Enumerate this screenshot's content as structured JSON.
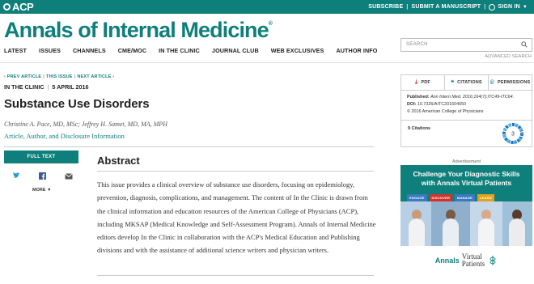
{
  "topbar": {
    "logo_text": "ACP",
    "links": [
      "SUBSCRIBE",
      "SUBMIT A MANUSCRIPT"
    ],
    "signin": "SIGN IN",
    "color": "#0e7f7b"
  },
  "masthead": {
    "title": "Annals of Internal Medicine",
    "mark": "®"
  },
  "search": {
    "placeholder": "SEARCH",
    "advanced": "ADVANCED SEARCH"
  },
  "nav": [
    "LATEST",
    "ISSUES",
    "CHANNELS",
    "CME/MOC",
    "IN THE CLINIC",
    "JOURNAL CLUB",
    "WEB EXCLUSIVES",
    "AUTHOR INFO"
  ],
  "article_nav": {
    "prev": "‹ PREV ARTICLE",
    "this": "THIS ISSUE",
    "next": "NEXT ARTICLE ›"
  },
  "article": {
    "section": "IN THE CLINIC",
    "date": "5 APRIL 2016",
    "title": "Substance Use Disorders",
    "authors": "Christine A. Pace, MD, MSc; Jeffrey H. Samet, MD, MA, MPH",
    "disclosure_link": "Article, Author, and Disclosure Information",
    "full_text_button": "FULL TEXT",
    "more": "MORE",
    "abstract_title": "Abstract",
    "abstract_text": "This issue provides a clinical overview of substance use disorders, focusing on epidemiology, prevention, diagnosis, complications, and management. The content of In the Clinic is drawn from the clinical information and education resources of the American College of Physicians (ACP), including MKSAP (Medical Knowledge and Self-Assessment Program). Annals of Internal Medicine editors develop In the Clinic in collaboration with the ACP's Medical Education and Publishing divisions and with the assistance of additional science writers and physician writers."
  },
  "tools": {
    "pdf": "PDF",
    "citations": "CITATIONS",
    "permissions": "PERMISSIONS"
  },
  "pubinfo": {
    "published_label": "Published:",
    "published_value": "Ann Intern Med. 2016;164(7):ITC49-ITC64.",
    "doi_label": "DOI:",
    "doi_value": "10.7326/AITC201604050",
    "copyright": "© 2016 American College of Physicians"
  },
  "citations": {
    "label": "9 Citations",
    "badge": "3"
  },
  "ad": {
    "label": "Advertisement",
    "headline_1": "Challenge Your Diagnostic Skills",
    "headline_2": "with Annals Virtual Patients",
    "tags": [
      "ENGAGE",
      "DISCOVER",
      "MANAGE",
      "LEARN"
    ],
    "tag_colors": [
      "#3a7bbf",
      "#d2332c",
      "#3a7bbf",
      "#e0a21a"
    ],
    "brand": "Annals",
    "brand_sub_1": "Virtual",
    "brand_sub_2": "Patients"
  }
}
